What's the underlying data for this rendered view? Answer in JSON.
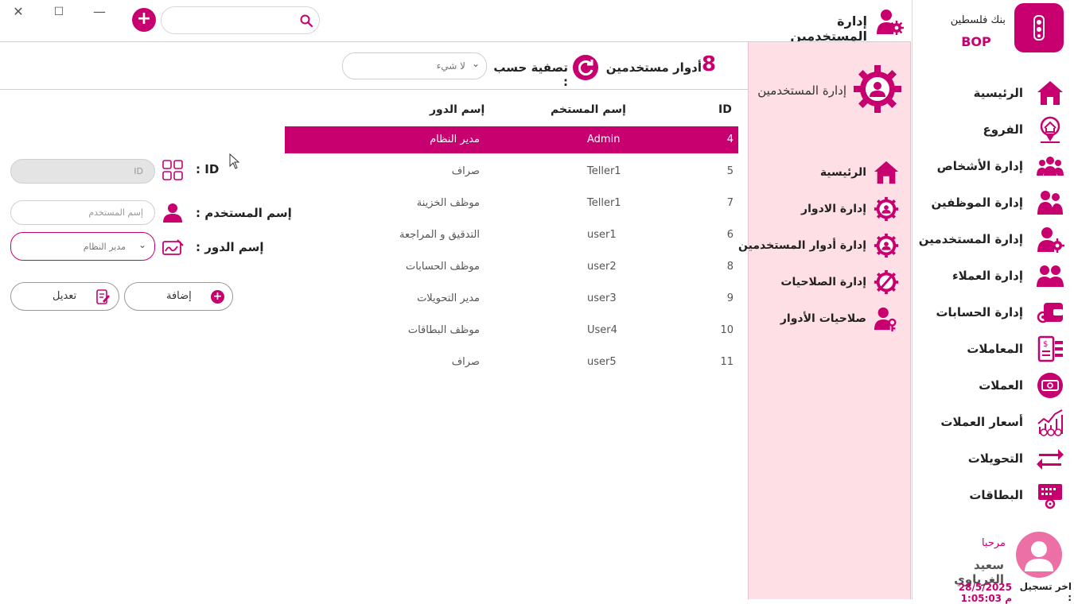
{
  "window": {
    "close": "✕",
    "maximize": "☐",
    "minimize": "—"
  },
  "header": {
    "title": "إدارة المستخدمين",
    "search": {
      "value": "",
      "placeholder": ""
    }
  },
  "brand": {
    "name": "بنك فلسطين",
    "short": "BOP"
  },
  "sidebar": {
    "items": [
      {
        "label": "الرئيسية",
        "icon": "home-icon"
      },
      {
        "label": "الفروع",
        "icon": "branch-location-icon"
      },
      {
        "label": "إدارة الأشخاص",
        "icon": "people-group-icon"
      },
      {
        "label": "إدارة الموظفين",
        "icon": "employees-icon"
      },
      {
        "label": "إدارة المستخدمين",
        "icon": "user-gear-icon"
      },
      {
        "label": "إدارة العملاء",
        "icon": "clients-icon"
      },
      {
        "label": "إدارة الحسابات",
        "icon": "wallet-gear-icon"
      },
      {
        "label": "المعاملات",
        "icon": "transactions-icon"
      },
      {
        "label": "العملات",
        "icon": "currency-icon"
      },
      {
        "label": "أسعار العملات",
        "icon": "exchange-rates-chart-icon"
      },
      {
        "label": "التحويلات",
        "icon": "transfer-arrows-icon"
      },
      {
        "label": "البطاقات",
        "icon": "cards-icon"
      }
    ],
    "welcome": "مرحبا",
    "username": "سعيد الغرباوي",
    "last_login_label": "اخر تسجيل :",
    "last_login_value": "28/5/2025 1:05:03 م"
  },
  "subpanel": {
    "title": "إدارة المستخدمين",
    "items": [
      {
        "label": "الرئيسية",
        "icon": "home-icon"
      },
      {
        "label": "إدارة الادوار",
        "icon": "role-gear-icon"
      },
      {
        "label": "إدارة أدوار المستخدمين",
        "icon": "user-roles-icon"
      },
      {
        "label": "إدارة الصلاحيات",
        "icon": "permissions-icon"
      },
      {
        "label": "صلاحيات الأدوار",
        "icon": "role-permissions-icon"
      }
    ]
  },
  "summary": {
    "count": "8",
    "label": "أدوار مستخدمين"
  },
  "filter": {
    "label": "تصفية حسب :",
    "selected": "لا شيء"
  },
  "table": {
    "headers": {
      "id": "ID",
      "username": "إسم المستخم",
      "role": "إسم الدور"
    },
    "rows": [
      {
        "id": "4",
        "username": "Admin",
        "role": "مدير النظام"
      },
      {
        "id": "5",
        "username": "Teller1",
        "role": "صراف"
      },
      {
        "id": "7",
        "username": "Teller1",
        "role": "موظف الخزينة"
      },
      {
        "id": "6",
        "username": "user1",
        "role": "التدقيق و المراجعة"
      },
      {
        "id": "8",
        "username": "user2",
        "role": "موظف الحسابات"
      },
      {
        "id": "9",
        "username": "user3",
        "role": "مدير التحويلات"
      },
      {
        "id": "10",
        "username": "User4",
        "role": "موظف البطاقات"
      },
      {
        "id": "11",
        "username": "user5",
        "role": "صراف"
      }
    ]
  },
  "form": {
    "id_label": "ID :",
    "id_placeholder": "ID",
    "username_label": "إسم المستخدم :",
    "username_placeholder": "إسم المستخدم",
    "role_label": "إسم الدور :",
    "role_selected": "مدير النظام",
    "add_label": "إضافة",
    "edit_label": "تعديل"
  },
  "colors": {
    "accent": "#c8006f",
    "panel": "#ffdfe6"
  }
}
